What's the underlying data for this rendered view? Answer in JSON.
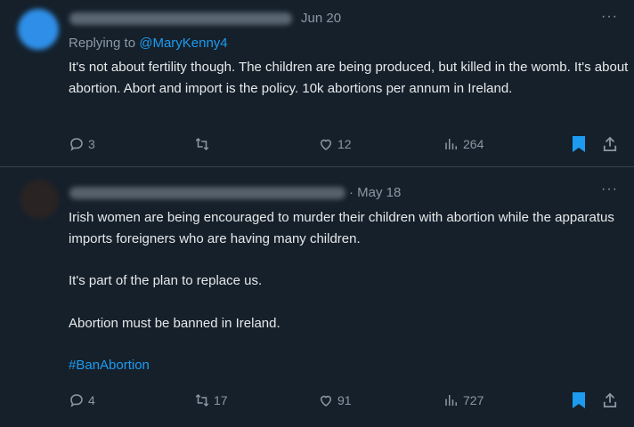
{
  "tweets": [
    {
      "date": "Jun 20",
      "replying_prefix": "Replying to ",
      "replying_handle": "@MaryKenny4",
      "paragraphs": [
        "It's not about fertility though.  The children are being produced, but killed in the womb.  It's about abortion.  Abort and import is the policy. 10k abortions per annum in Ireland."
      ],
      "replies": "3",
      "retweets": "",
      "likes": "12",
      "views": "264"
    },
    {
      "date": "· May 18",
      "paragraphs": [
        "Irish women are being encouraged to murder their children with abortion while the apparatus imports foreigners who are having many children.",
        "It's part of the plan to replace us.",
        "Abortion must be banned in Ireland."
      ],
      "hashtag": "#BanAbortion",
      "replies": "4",
      "retweets": "17",
      "likes": "91",
      "views": "727"
    }
  ],
  "more_glyph": "···",
  "icons": [
    "comment-icon",
    "retweet-icon",
    "heart-icon",
    "views-icon",
    "bookmark-icon",
    "share-icon",
    "more-icon"
  ],
  "colors": {
    "background": "#15202b",
    "accent": "#1d9bf0",
    "muted": "#8b98a5",
    "divider": "#38444d"
  }
}
